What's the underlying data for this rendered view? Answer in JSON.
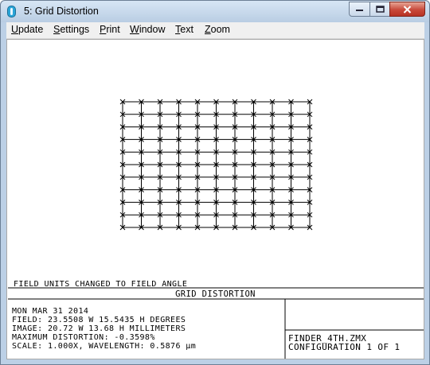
{
  "window": {
    "title": "5: Grid Distortion",
    "controls": [
      "minimize-icon",
      "maximize-icon",
      "close-icon"
    ]
  },
  "menu": {
    "items": [
      {
        "label": "Update",
        "accel": "U",
        "rest": "pdate"
      },
      {
        "label": "Settings",
        "accel": "S",
        "rest": "ettings"
      },
      {
        "label": "Print",
        "accel": "P",
        "rest": "rint"
      },
      {
        "label": "Window",
        "accel": "W",
        "rest": "indow"
      },
      {
        "label": "Text",
        "accel": "T",
        "rest": "ext"
      },
      {
        "label": "Zoom",
        "accel": "Z",
        "rest": "oom"
      }
    ]
  },
  "grid": {
    "columns": 11,
    "rows": 11,
    "max_distortion_percent": -0.3598
  },
  "footer": {
    "note": "FIELD UNITS CHANGED TO FIELD ANGLE",
    "plot_title": "GRID DISTORTION",
    "info_lines": [
      "MON MAR 31 2014",
      "FIELD: 23.5508 W 15.5435 H DEGREES",
      "IMAGE: 20.72 W 13.68 H MILLIMETERS",
      "MAXIMUM DISTORTION: -0.3598%",
      "SCALE: 1.000X, WAVELENGTH: 0.5876 µm"
    ],
    "file_name": "FINDER_4TH.ZMX",
    "configuration": "CONFIGURATION 1 OF 1"
  },
  "colors": {
    "frame": "#bcd0e6",
    "close_button": "#c8493a",
    "plot_ink": "#000000"
  }
}
